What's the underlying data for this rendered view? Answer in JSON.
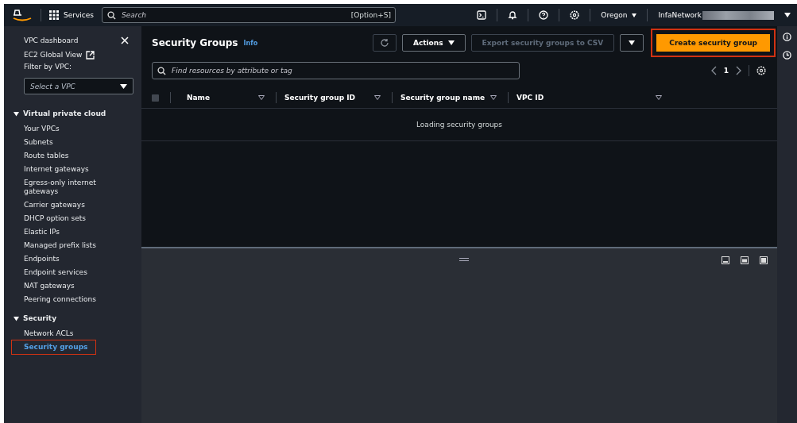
{
  "top_nav": {
    "services_label": "Services",
    "search": {
      "placeholder": "Search",
      "shortcut": "[Option+S]"
    },
    "region": "Oregon",
    "account": "InfaNetwork",
    "account_redacted": true
  },
  "sidebar": {
    "dashboard": "VPC dashboard",
    "global_view": "EC2 Global View",
    "filter_label": "Filter by VPC:",
    "filter_placeholder": "Select a VPC",
    "sections": [
      {
        "title": "Virtual private cloud",
        "expanded": true,
        "items": [
          {
            "label": "Your VPCs",
            "selected": false,
            "highlighted": false
          },
          {
            "label": "Subnets",
            "selected": false,
            "highlighted": false
          },
          {
            "label": "Route tables",
            "selected": false,
            "highlighted": false
          },
          {
            "label": "Internet gateways",
            "selected": false,
            "highlighted": false
          },
          {
            "label": "Egress-only internet gateways",
            "selected": false,
            "highlighted": false
          },
          {
            "label": "Carrier gateways",
            "selected": false,
            "highlighted": false
          },
          {
            "label": "DHCP option sets",
            "selected": false,
            "highlighted": false
          },
          {
            "label": "Elastic IPs",
            "selected": false,
            "highlighted": false
          },
          {
            "label": "Managed prefix lists",
            "selected": false,
            "highlighted": false
          },
          {
            "label": "Endpoints",
            "selected": false,
            "highlighted": false
          },
          {
            "label": "Endpoint services",
            "selected": false,
            "highlighted": false
          },
          {
            "label": "NAT gateways",
            "selected": false,
            "highlighted": false
          },
          {
            "label": "Peering connections",
            "selected": false,
            "highlighted": false
          }
        ]
      },
      {
        "title": "Security",
        "expanded": true,
        "items": [
          {
            "label": "Network ACLs",
            "selected": false,
            "highlighted": false
          },
          {
            "label": "Security groups",
            "selected": true,
            "highlighted": true
          }
        ]
      }
    ]
  },
  "main": {
    "title": "Security Groups",
    "info": "Info",
    "actions": "Actions",
    "export": {
      "label": "Export security groups to CSV",
      "disabled": true
    },
    "create": {
      "label": "Create security group",
      "highlighted": true
    },
    "search_placeholder": "Find resources by attribute or tag",
    "page": "1",
    "table": {
      "select_all_checked": false,
      "columns": [
        "Name",
        "Security group ID",
        "Security group name",
        "VPC ID"
      ],
      "status": "Loading security groups"
    }
  }
}
